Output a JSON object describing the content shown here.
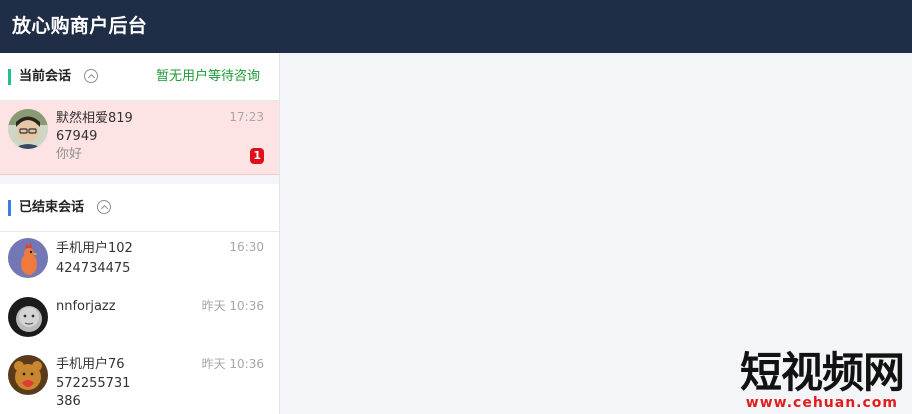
{
  "app": {
    "title": "放心购商户后台"
  },
  "current_section": {
    "title": "当前会话",
    "status": "暂无用户等待咨询",
    "accent": "#1fbf8f",
    "conversations": [
      {
        "name": "默然相爱819",
        "line2": "67949",
        "preview": "你好",
        "time": "17:23",
        "unread": "1",
        "avatar_icon": "avatar-photo-icon"
      }
    ]
  },
  "ended_section": {
    "title": "已结束会话",
    "accent": "#3b7be8",
    "conversations": [
      {
        "name": "手机用户102",
        "line2": "424734475",
        "time": "16:30",
        "avatar_icon": "avatar-chicken-icon"
      },
      {
        "name": "nnforjazz",
        "time": "昨天 10:36",
        "avatar_icon": "avatar-baby-icon"
      },
      {
        "name": "手机用户76",
        "line2": "572255731",
        "line3": "386",
        "time": "昨天 10:36",
        "avatar_icon": "avatar-bear-icon"
      }
    ]
  },
  "watermark": {
    "title": "短视频网",
    "url": "www.cehuan.com"
  }
}
